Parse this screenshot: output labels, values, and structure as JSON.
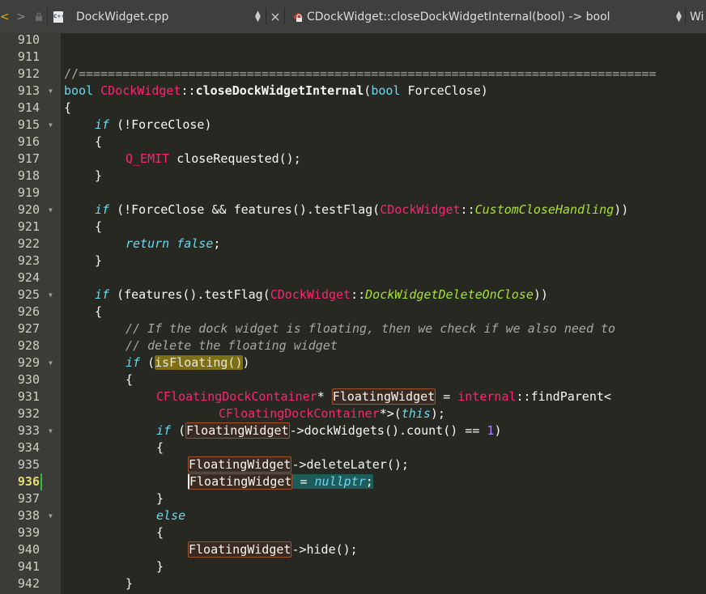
{
  "toolbar": {
    "back_glyph": "<",
    "forward_glyph": ">",
    "file_name": "DockWidget.cpp",
    "file_icon_text": "C++",
    "close_glyph": "×",
    "symbol": "CDockWidget::closeDockWidgetInternal(bool) -> bool",
    "right_tab": "Wi"
  },
  "editor": {
    "current_line": "936",
    "lines": [
      {
        "n": "910"
      },
      {
        "n": "911"
      },
      {
        "n": "912"
      },
      {
        "n": "913"
      },
      {
        "n": "914"
      },
      {
        "n": "915"
      },
      {
        "n": "916"
      },
      {
        "n": "917"
      },
      {
        "n": "918"
      },
      {
        "n": "919"
      },
      {
        "n": "920"
      },
      {
        "n": "921"
      },
      {
        "n": "922"
      },
      {
        "n": "923"
      },
      {
        "n": "924"
      },
      {
        "n": "925"
      },
      {
        "n": "926"
      },
      {
        "n": "927"
      },
      {
        "n": "928"
      },
      {
        "n": "929"
      },
      {
        "n": "930"
      },
      {
        "n": "931"
      },
      {
        "n": "932"
      },
      {
        "n": "933"
      },
      {
        "n": "934"
      },
      {
        "n": "935"
      },
      {
        "n": "936"
      },
      {
        "n": "937"
      },
      {
        "n": "938"
      },
      {
        "n": "939"
      },
      {
        "n": "940"
      },
      {
        "n": "941"
      },
      {
        "n": "942"
      }
    ],
    "code": {
      "l912": "//===============================================================================",
      "l913_bool": "bool",
      "l913_cls": "CDockWidget",
      "l913_sep": "::",
      "l913_fn": "closeDockWidgetInternal",
      "l913_open": "(",
      "l913_ptype": "bool",
      "l913_param": " ForceClose)",
      "l914": "{",
      "l915_if": "if",
      "l915_rest": " (!ForceClose)",
      "l916": "{",
      "l917_mac": "Q_EMIT",
      "l917_rest": " closeRequested();",
      "l918": "}",
      "l920_if": "if",
      "l920_a": " (!ForceClose && features().testFlag(",
      "l920_cls": "CDockWidget",
      "l920_sep": "::",
      "l920_enum": "CustomCloseHandling",
      "l920_b": "))",
      "l921": "{",
      "l922_ret": "return",
      "l922_sp": " ",
      "l922_false": "false",
      "l922_end": ";",
      "l923": "}",
      "l925_if": "if",
      "l925_a": " (features().testFlag(",
      "l925_cls": "CDockWidget",
      "l925_sep": "::",
      "l925_enum": "DockWidgetDeleteOnClose",
      "l925_b": "))",
      "l926": "{",
      "l927": "// If the dock widget is floating, then we check if we also need to",
      "l928": "// delete the floating widget",
      "l929_if": "if",
      "l929_a": " (",
      "l929_call": "isFloating()",
      "l929_b": ")",
      "l930": "{",
      "l931_cls": "CFloatingDockContainer",
      "l931_star": "* ",
      "l931_var": "FloatingWidget",
      "l931_eq": " = ",
      "l931_ns": "internal",
      "l931_rest": "::findParent<",
      "l932_cls": "CFloatingDockContainer",
      "l932_a": "*>(",
      "l932_this": "this",
      "l932_b": ");",
      "l933_if": "if",
      "l933_a": " (",
      "l933_var": "FloatingWidget",
      "l933_b": "->dockWidgets().count() == ",
      "l933_num": "1",
      "l933_c": ")",
      "l934": "{",
      "l935_var": "FloatingWidget",
      "l935_rest": "->deleteLater();",
      "l936_var": "FloatingWidget",
      "l936_eq": " = ",
      "l936_null": "nullptr",
      "l936_end": ";",
      "l937": "}",
      "l938_else": "else",
      "l939": "{",
      "l940_var": "FloatingWidget",
      "l940_rest": "->hide();",
      "l941": "}",
      "l942": "}"
    }
  },
  "colors": {
    "background": "#272822",
    "gutter": "#3b3c37",
    "keyword": "#66d9ef",
    "class_name": "#f92672",
    "enum_value": "#a6e22e",
    "comment": "#a8a8a0",
    "number": "#ae81ff",
    "highlight": "#7d6f12",
    "selection": "#1e5c5c",
    "current_line_number": "#e6db74"
  }
}
